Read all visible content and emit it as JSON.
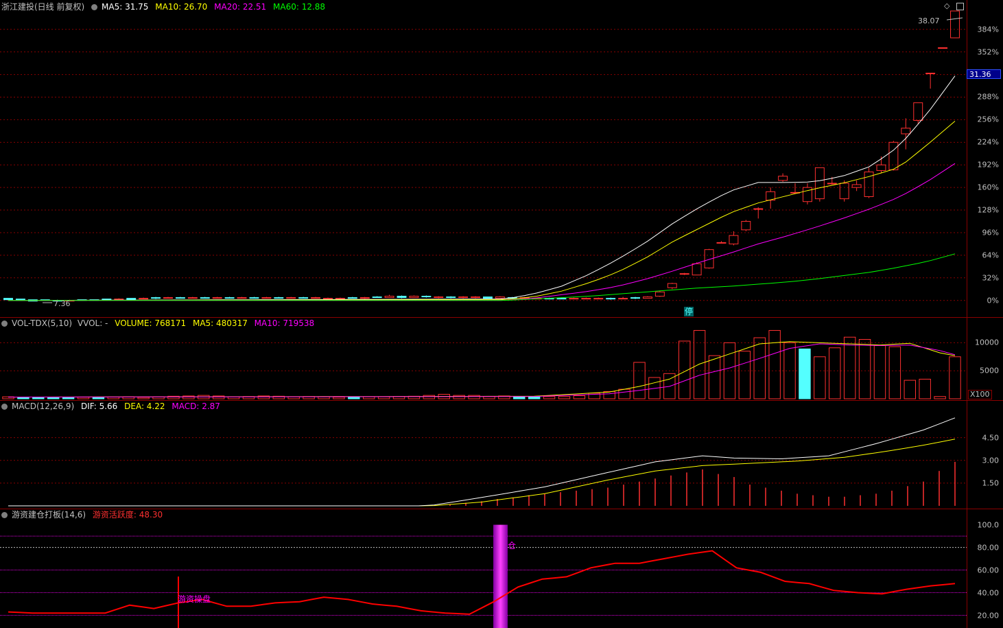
{
  "colors": {
    "up": "#ff3030",
    "down": "#54ffff",
    "ma5": "#ffffff",
    "ma10": "#ffff00",
    "ma20": "#ff00ff",
    "ma60": "#00ff00",
    "grid": "#8b0000",
    "axis_text": "#c0c0c0",
    "macd_dif": "#ffffff",
    "macd_dea": "#ffff00",
    "activity": "#ff0000",
    "marker": "#e000e0"
  },
  "main": {
    "title": "浙江建投(日线 前复权)",
    "ma5_label": "MA5: 31.75",
    "ma10_label": "MA10: 26.70",
    "ma20_label": "MA20: 22.51",
    "ma60_label": "MA60: 12.88",
    "high_label": "38.07",
    "low_label": "7.36",
    "current_price": "31.36",
    "limit_tag": "停"
  },
  "volume": {
    "title": "VOL-TDX(5,10)",
    "vol_label": "VVOL: -",
    "volume_label": "VOLUME: 768171",
    "ma5_label": "MA5: 480317",
    "ma10_label": "MA10: 719538",
    "unit": "X100"
  },
  "macd": {
    "title": "MACD(12,26,9)",
    "dif_label": "DIF: 5.66",
    "dea_label": "DEA: 4.22",
    "macd_label": "MACD: 2.87"
  },
  "activity": {
    "title": "游资建仓打板(14,6)",
    "value_label": "游资活跃度: 48.30",
    "marker_text": "游资操盘",
    "marker_text2": "仓"
  },
  "chart_data": [
    {
      "type": "candlestick",
      "panel": "price",
      "y_axis_unit": "%",
      "y_ticks": [
        "384%",
        "352%",
        "288%",
        "256%",
        "224%",
        "192%",
        "160%",
        "128%",
        "96%",
        "64%",
        "32%",
        "0%"
      ],
      "ylim": [
        -10,
        410
      ],
      "candles_pct": [
        [
          3,
          1,
          3,
          1
        ],
        [
          2,
          0,
          2,
          0
        ],
        [
          1,
          -1,
          1,
          -1
        ],
        [
          1,
          0,
          1,
          0
        ],
        [
          0,
          -1,
          1,
          -1
        ],
        [
          0,
          0,
          1,
          -1
        ],
        [
          1,
          0,
          1,
          0
        ],
        [
          1,
          0,
          1,
          0
        ],
        [
          2,
          1,
          2,
          1
        ],
        [
          1,
          2,
          3,
          1
        ],
        [
          3,
          1,
          3,
          1
        ],
        [
          2,
          3,
          4,
          2
        ],
        [
          4,
          3,
          5,
          2
        ],
        [
          3,
          4,
          5,
          3
        ],
        [
          4,
          3,
          5,
          3
        ],
        [
          3,
          4,
          5,
          3
        ],
        [
          4,
          3,
          5,
          3
        ],
        [
          3,
          4,
          5,
          3
        ],
        [
          4,
          3,
          5,
          3
        ],
        [
          3,
          4,
          5,
          3
        ],
        [
          4,
          3,
          5,
          3
        ],
        [
          3,
          4,
          5,
          3
        ],
        [
          4,
          3,
          5,
          3
        ],
        [
          3,
          4,
          5,
          3
        ],
        [
          4,
          3,
          5,
          3
        ],
        [
          3,
          4,
          5,
          3
        ],
        [
          2,
          3,
          4,
          2
        ],
        [
          2,
          3,
          4,
          2
        ],
        [
          4,
          3,
          5,
          3
        ],
        [
          3,
          4,
          5,
          2
        ],
        [
          5,
          4,
          6,
          4
        ],
        [
          4,
          6,
          8,
          4
        ],
        [
          6,
          4,
          7,
          3
        ],
        [
          4,
          6,
          7,
          4
        ],
        [
          6,
          5,
          7,
          4
        ],
        [
          4,
          5,
          6,
          3
        ],
        [
          5,
          4,
          6,
          3
        ],
        [
          4,
          5,
          6,
          3
        ],
        [
          4,
          5,
          6,
          3
        ],
        [
          5,
          3,
          5,
          3
        ],
        [
          3,
          5,
          6,
          3
        ],
        [
          4,
          3,
          5,
          2
        ],
        [
          3,
          4,
          5,
          2
        ],
        [
          2,
          3,
          4,
          2
        ],
        [
          3,
          2,
          4,
          2
        ],
        [
          3,
          2,
          4,
          2
        ],
        [
          2,
          3,
          4,
          2
        ],
        [
          2,
          3,
          4,
          2
        ],
        [
          2,
          3,
          4,
          2
        ],
        [
          3,
          2,
          4,
          1
        ],
        [
          2,
          3,
          5,
          2
        ],
        [
          4,
          3,
          5,
          2
        ],
        [
          3,
          5,
          6,
          3
        ],
        [
          6,
          12,
          14,
          5
        ],
        [
          18,
          24,
          25,
          16
        ],
        [
          38,
          38,
          39,
          36
        ],
        [
          36,
          52,
          54,
          36
        ],
        [
          46,
          72,
          73,
          45
        ],
        [
          82,
          82,
          84,
          81
        ],
        [
          80,
          92,
          98,
          78
        ],
        [
          100,
          112,
          114,
          98
        ],
        [
          130,
          130,
          132,
          116
        ],
        [
          142,
          154,
          160,
          130
        ],
        [
          170,
          176,
          180,
          168
        ],
        [
          153,
          153,
          166,
          151
        ],
        [
          140,
          160,
          166,
          136
        ],
        [
          144,
          188,
          188,
          140
        ],
        [
          166,
          166,
          175,
          164
        ],
        [
          144,
          166,
          170,
          140
        ],
        [
          160,
          164,
          170,
          155
        ],
        [
          147,
          182,
          188,
          145
        ],
        [
          184,
          192,
          204,
          180
        ],
        [
          185,
          224,
          226,
          184
        ],
        [
          236,
          244,
          258,
          214
        ],
        [
          255,
          280,
          280,
          250
        ],
        [
          322,
          322,
          322,
          300
        ],
        [
          358,
          358,
          358,
          358
        ],
        [
          372,
          410,
          410,
          372
        ]
      ],
      "ma5_pct_samples": [
        [
          0,
          0
        ],
        [
          53,
          2
        ],
        [
          56,
          9
        ],
        [
          59,
          20
        ],
        [
          62,
          37
        ],
        [
          65,
          58
        ],
        [
          68,
          82
        ],
        [
          71,
          110
        ],
        [
          74,
          134
        ],
        [
          77,
          155
        ],
        [
          80,
          167
        ],
        [
          83,
          167
        ],
        [
          86,
          168
        ],
        [
          89,
          176
        ],
        [
          92,
          190
        ],
        [
          95,
          218
        ],
        [
          98,
          264
        ],
        [
          101,
          318
        ]
      ],
      "ma10_pct_samples": [
        [
          0,
          0
        ],
        [
          53,
          1
        ],
        [
          56,
          5
        ],
        [
          59,
          13
        ],
        [
          62,
          25
        ],
        [
          65,
          40
        ],
        [
          68,
          60
        ],
        [
          71,
          84
        ],
        [
          74,
          104
        ],
        [
          77,
          124
        ],
        [
          80,
          138
        ],
        [
          83,
          148
        ],
        [
          86,
          158
        ],
        [
          89,
          166
        ],
        [
          92,
          176
        ],
        [
          95,
          188
        ],
        [
          98,
          220
        ],
        [
          101,
          254
        ]
      ],
      "ma20_pct_samples": [
        [
          0,
          0
        ],
        [
          53,
          0
        ],
        [
          56,
          3
        ],
        [
          59,
          8
        ],
        [
          62,
          13
        ],
        [
          65,
          20
        ],
        [
          68,
          30
        ],
        [
          71,
          42
        ],
        [
          74,
          55
        ],
        [
          77,
          67
        ],
        [
          80,
          80
        ],
        [
          83,
          91
        ],
        [
          86,
          103
        ],
        [
          89,
          116
        ],
        [
          92,
          130
        ],
        [
          95,
          146
        ],
        [
          98,
          168
        ],
        [
          101,
          194
        ]
      ],
      "ma60_pct_samples": [
        [
          0,
          0
        ],
        [
          53,
          0
        ],
        [
          56,
          2
        ],
        [
          59,
          4
        ],
        [
          62,
          6
        ],
        [
          65,
          9
        ],
        [
          68,
          12
        ],
        [
          71,
          15
        ],
        [
          74,
          18
        ],
        [
          77,
          20
        ],
        [
          80,
          23
        ],
        [
          83,
          26
        ],
        [
          86,
          30
        ],
        [
          89,
          35
        ],
        [
          92,
          40
        ],
        [
          95,
          47
        ],
        [
          98,
          55
        ],
        [
          101,
          66
        ]
      ]
    },
    {
      "type": "bar",
      "panel": "volume",
      "y_ticks": [
        "10000",
        "5000"
      ],
      "ylim": [
        0,
        12500
      ],
      "bars_x100": [
        350,
        200,
        300,
        300,
        250,
        280,
        300,
        300,
        350,
        250,
        350,
        450,
        500,
        600,
        500,
        350,
        400,
        500,
        450,
        350,
        400,
        350,
        300,
        300,
        350,
        350,
        400,
        450,
        600,
        800,
        600,
        600,
        400,
        500,
        400,
        350,
        400,
        400,
        550,
        1000,
        1300,
        1700,
        6500,
        3800,
        4500,
        10300,
        12200,
        7700,
        10000,
        8500,
        10900,
        12200,
        10000,
        8900,
        7500,
        9100,
        11000,
        10600,
        9500,
        9300,
        3300,
        3500,
        400,
        7500
      ],
      "bar_up": [
        1,
        0,
        0,
        0,
        0,
        1,
        0,
        1,
        1,
        1,
        1,
        1,
        1,
        1,
        1,
        1,
        1,
        1,
        1,
        1,
        1,
        1,
        1,
        0,
        1,
        1,
        1,
        1,
        1,
        1,
        1,
        1,
        1,
        1,
        0,
        0,
        1,
        1,
        1,
        1,
        1,
        1,
        1,
        1,
        1,
        1,
        1,
        1,
        1,
        1,
        1,
        1,
        1,
        0,
        1,
        1,
        1,
        1,
        1,
        1,
        1,
        1,
        1,
        1
      ],
      "ma5_x100": [
        [
          0,
          300
        ],
        [
          35,
          450
        ],
        [
          40,
          1200
        ],
        [
          42,
          2200
        ],
        [
          44,
          3500
        ],
        [
          46,
          6200
        ],
        [
          48,
          8000
        ],
        [
          50,
          9800
        ],
        [
          52,
          10200
        ],
        [
          54,
          10000
        ],
        [
          56,
          9800
        ],
        [
          58,
          9600
        ],
        [
          60,
          9900
        ],
        [
          62,
          8200
        ],
        [
          64,
          7200
        ]
      ],
      "ma10_x100": [
        [
          0,
          300
        ],
        [
          35,
          400
        ],
        [
          40,
          900
        ],
        [
          42,
          1500
        ],
        [
          44,
          2200
        ],
        [
          46,
          4200
        ],
        [
          48,
          5500
        ],
        [
          50,
          7200
        ],
        [
          52,
          9000
        ],
        [
          54,
          9800
        ],
        [
          56,
          9600
        ],
        [
          58,
          9500
        ],
        [
          60,
          9600
        ],
        [
          62,
          8600
        ],
        [
          64,
          7100
        ]
      ]
    },
    {
      "type": "line",
      "panel": "macd",
      "y_ticks": [
        "4.50",
        "3.00",
        "1.50"
      ],
      "ylim": [
        0,
        6.2
      ],
      "dif_samples": [
        [
          0,
          0
        ],
        [
          26,
          0
        ],
        [
          27,
          0.06
        ],
        [
          30,
          0.55
        ],
        [
          34,
          1.25
        ],
        [
          38,
          2.2
        ],
        [
          41,
          2.9
        ],
        [
          44,
          3.3
        ],
        [
          46,
          3.15
        ],
        [
          49,
          3.1
        ],
        [
          52,
          3.3
        ],
        [
          55,
          4.1
        ],
        [
          58,
          5.0
        ],
        [
          60,
          5.8
        ]
      ],
      "dea_samples": [
        [
          0,
          0
        ],
        [
          26,
          0
        ],
        [
          27,
          0.02
        ],
        [
          30,
          0.25
        ],
        [
          34,
          0.8
        ],
        [
          38,
          1.7
        ],
        [
          41,
          2.3
        ],
        [
          44,
          2.65
        ],
        [
          47,
          2.8
        ],
        [
          50,
          2.95
        ],
        [
          53,
          3.2
        ],
        [
          56,
          3.65
        ],
        [
          58,
          4.0
        ],
        [
          60,
          4.4
        ]
      ],
      "macd_bars_x": [
        27,
        28,
        29,
        30,
        31,
        32,
        33,
        34,
        35,
        36,
        37,
        38,
        39,
        40,
        41,
        42,
        43,
        44,
        45,
        46,
        47,
        48,
        49,
        50,
        51,
        52,
        53,
        54,
        55,
        56,
        57,
        58,
        59,
        60
      ],
      "macd_bars": [
        0.05,
        0.1,
        0.2,
        0.3,
        0.45,
        0.55,
        0.7,
        0.8,
        0.9,
        1.0,
        1.1,
        1.2,
        1.4,
        1.6,
        1.8,
        2.0,
        2.2,
        2.4,
        2.1,
        1.9,
        1.4,
        1.2,
        1.0,
        0.8,
        0.7,
        0.6,
        0.6,
        0.7,
        0.8,
        1.0,
        1.3,
        1.6,
        2.3,
        2.9
      ]
    },
    {
      "type": "line",
      "panel": "activity",
      "y_ticks": [
        "100.0",
        "80.00",
        "60.00",
        "40.00",
        "20.00"
      ],
      "ylim": [
        10,
        104
      ],
      "activity_samples": [
        [
          0,
          23
        ],
        [
          2,
          22
        ],
        [
          4,
          22
        ],
        [
          6,
          22
        ],
        [
          8,
          22
        ],
        [
          10,
          29
        ],
        [
          12,
          26
        ],
        [
          14,
          31
        ],
        [
          16,
          34
        ],
        [
          18,
          28
        ],
        [
          20,
          28
        ],
        [
          22,
          31
        ],
        [
          24,
          32
        ],
        [
          26,
          36
        ],
        [
          28,
          34
        ],
        [
          30,
          30
        ],
        [
          32,
          28
        ],
        [
          34,
          24
        ],
        [
          36,
          22
        ],
        [
          38,
          21
        ],
        [
          40,
          32
        ],
        [
          42,
          45
        ],
        [
          44,
          52
        ],
        [
          46,
          54
        ],
        [
          48,
          62
        ],
        [
          50,
          66
        ],
        [
          52,
          66
        ],
        [
          54,
          70
        ],
        [
          56,
          74
        ],
        [
          58,
          77
        ],
        [
          60,
          62
        ],
        [
          62,
          58
        ],
        [
          64,
          50
        ],
        [
          66,
          48
        ],
        [
          68,
          42
        ],
        [
          70,
          40
        ],
        [
          72,
          39
        ],
        [
          74,
          43
        ],
        [
          76,
          46
        ],
        [
          78,
          48
        ]
      ],
      "grid_levels": [
        90,
        80,
        60,
        40,
        20
      ]
    }
  ]
}
